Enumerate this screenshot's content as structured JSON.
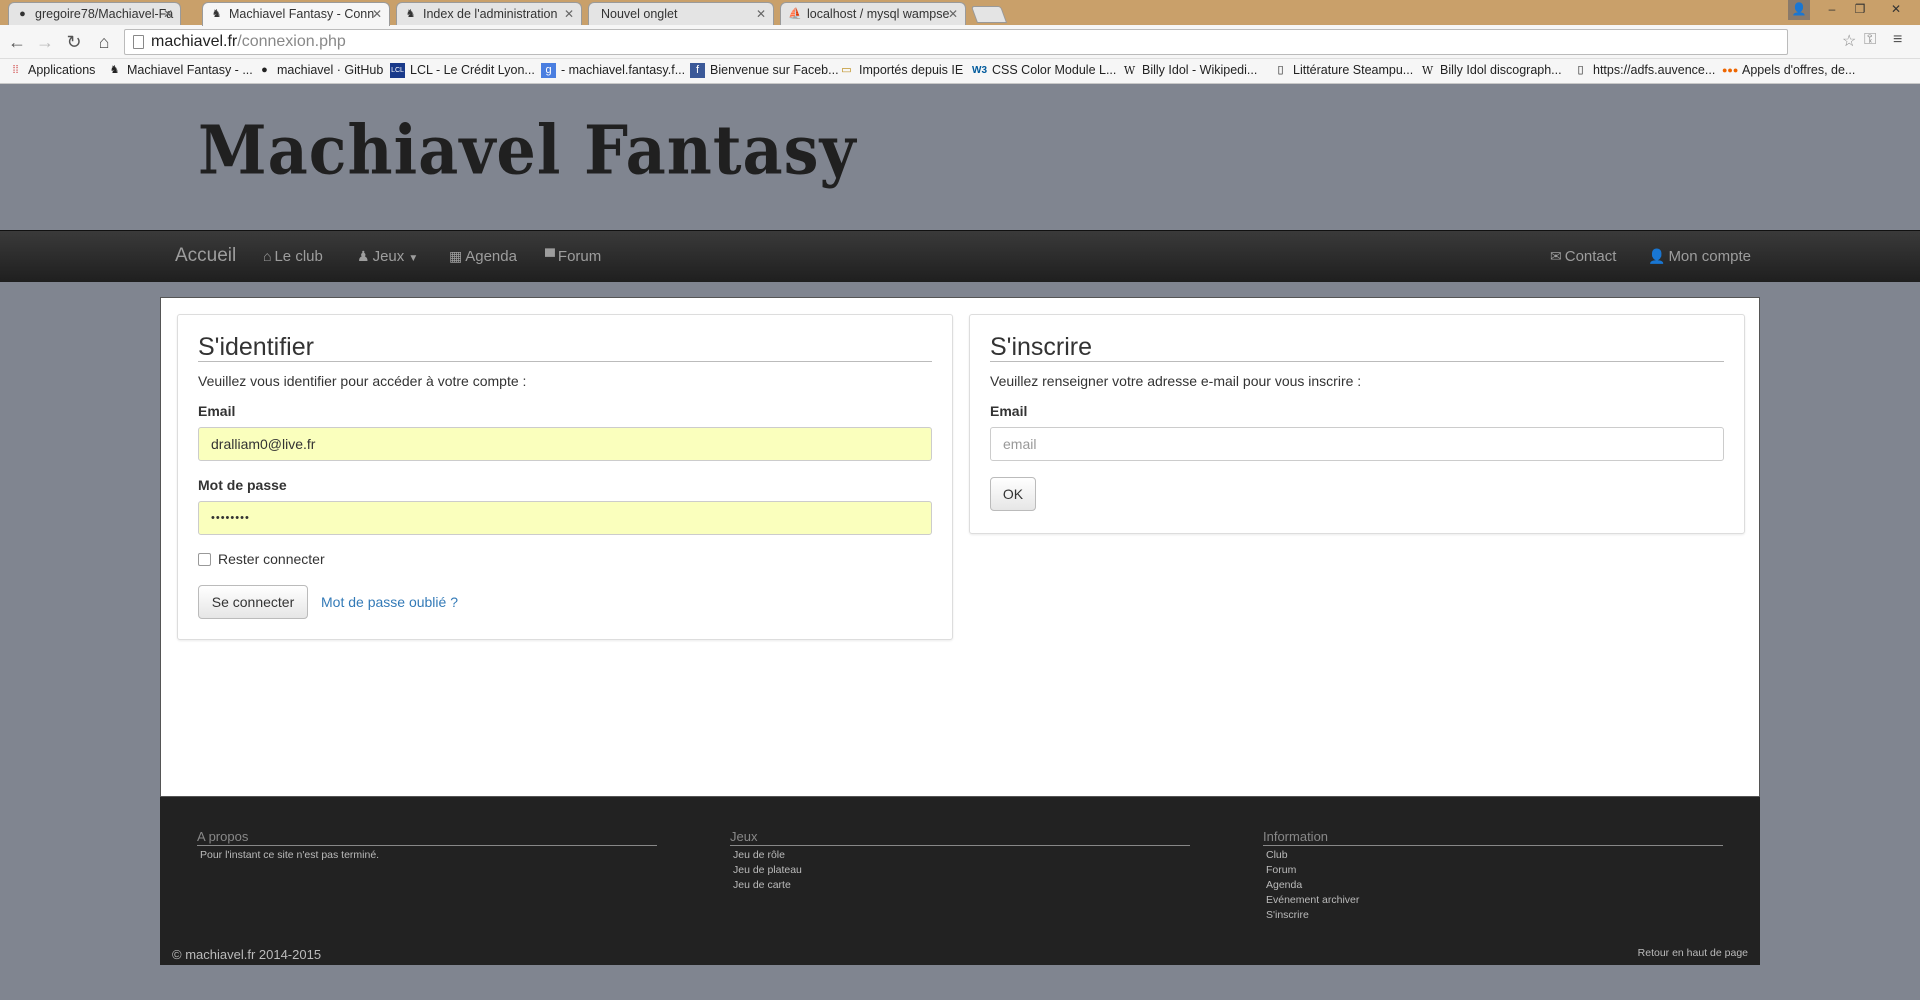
{
  "browser": {
    "tabs": [
      {
        "title": "gregoire78/Machiavel-Fa",
        "icon": "github-icon"
      },
      {
        "title": "Machiavel Fantasy - Conn",
        "icon": "site-favicon",
        "active": true
      },
      {
        "title": "Index de l'administration",
        "icon": "site-favicon"
      },
      {
        "title": "Nouvel onglet",
        "icon": ""
      },
      {
        "title": "localhost / mysql wampse",
        "icon": "phpmyadmin-icon"
      }
    ],
    "url_host": "machiavel.fr",
    "url_path": "/connexion.php",
    "bookmarks": [
      {
        "label": "Applications",
        "icon": "apps-grid-icon"
      },
      {
        "label": "Machiavel Fantasy - ...",
        "icon": "site-favicon"
      },
      {
        "label": "machiavel · GitHub",
        "icon": "github-icon"
      },
      {
        "label": "LCL - Le Crédit Lyon...",
        "icon": "lcl-icon"
      },
      {
        "label": "- machiavel.fantasy.f...",
        "icon": "google-icon"
      },
      {
        "label": "Bienvenue sur Faceb...",
        "icon": "facebook-icon"
      },
      {
        "label": "Importés depuis IE",
        "icon": "folder-icon"
      },
      {
        "label": "CSS Color Module L...",
        "icon": "w3c-icon"
      },
      {
        "label": "Billy Idol - Wikipedi...",
        "icon": "wikipedia-icon"
      },
      {
        "label": "Littérature Steampu...",
        "icon": "page-icon"
      },
      {
        "label": "Billy Idol discograph...",
        "icon": "wikipedia-icon"
      },
      {
        "label": "https://adfs.auvence...",
        "icon": "page-icon"
      },
      {
        "label": "Appels d'offres, de...",
        "icon": "dots-icon"
      }
    ]
  },
  "site": {
    "logo": "Machiavel  Fantasy",
    "nav": {
      "brand": "Accueil",
      "items": [
        {
          "label": "Le club",
          "icon": "home-icon"
        },
        {
          "label": "Jeux",
          "icon": "pawn-icon",
          "dropdown": true
        },
        {
          "label": "Agenda",
          "icon": "calendar-icon"
        },
        {
          "label": "Forum",
          "icon": "comment-icon"
        }
      ],
      "right": [
        {
          "label": "Contact",
          "icon": "envelope-icon"
        },
        {
          "label": "Mon compte",
          "icon": "user-icon"
        }
      ]
    }
  },
  "login": {
    "title": "S'identifier",
    "intro": "Veuillez vous identifier pour accéder à votre compte :",
    "email_label": "Email",
    "email_value": "dralliam0@live.fr",
    "password_label": "Mot de passe",
    "password_value": "••••••••",
    "remember_label": "Rester connecter",
    "submit_label": "Se connecter",
    "forgot_label": "Mot de passe oublié ?"
  },
  "register": {
    "title": "S'inscrire",
    "intro": "Veuillez renseigner votre adresse e-mail pour vous inscrire :",
    "email_label": "Email",
    "email_placeholder": "email",
    "submit_label": "OK"
  },
  "footer": {
    "about": {
      "title": "A propos",
      "items": [
        "Pour l'instant ce site n'est pas terminé."
      ]
    },
    "games": {
      "title": "Jeux",
      "items": [
        "Jeu de rôle",
        "Jeu de plateau",
        "Jeu de carte"
      ]
    },
    "info": {
      "title": "Information",
      "items": [
        "Club",
        "Forum",
        "Agenda",
        "Evénement archiver",
        "S'inscrire"
      ]
    },
    "copyright": "© machiavel.fr 2014-2015",
    "back_to_top": "Retour en haut de page"
  },
  "colors": {
    "page_bg": "#808590",
    "navbar_bg": "#222222",
    "autofill_bg": "#faffbd",
    "link": "#337ab7"
  }
}
